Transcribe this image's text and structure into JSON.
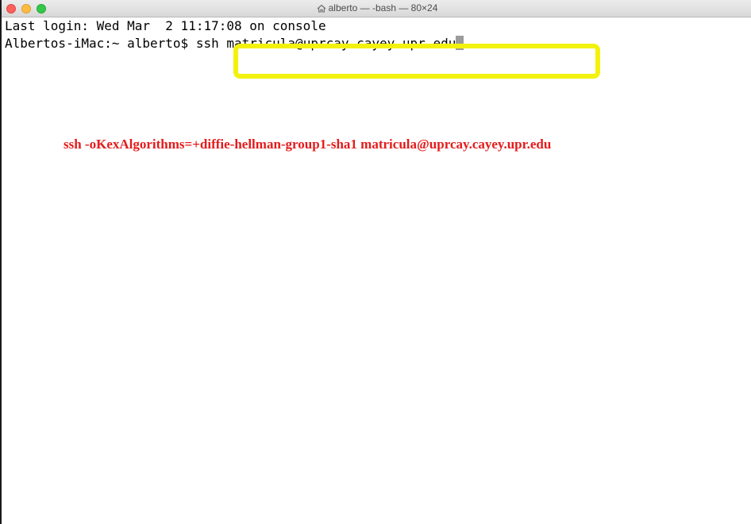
{
  "window": {
    "title": "alberto — -bash — 80×24",
    "title_icon": "home-icon"
  },
  "terminal": {
    "line1": "Last login: Wed Mar  2 11:17:08 on console",
    "prompt": "Albertos-iMac:~ alberto$ ",
    "command": "ssh matricula@uprcay.cayey.upr.edu"
  },
  "annotation": {
    "text": "ssh -oKexAlgorithms=+diffie-hellman-group1-sha1 matricula@uprcay.cayey.upr.edu",
    "color": "#e51b1b"
  },
  "colors": {
    "highlight": "#f2f20e",
    "close": "#fc605c",
    "minimize": "#fdbc40",
    "maximize": "#34c84a"
  }
}
